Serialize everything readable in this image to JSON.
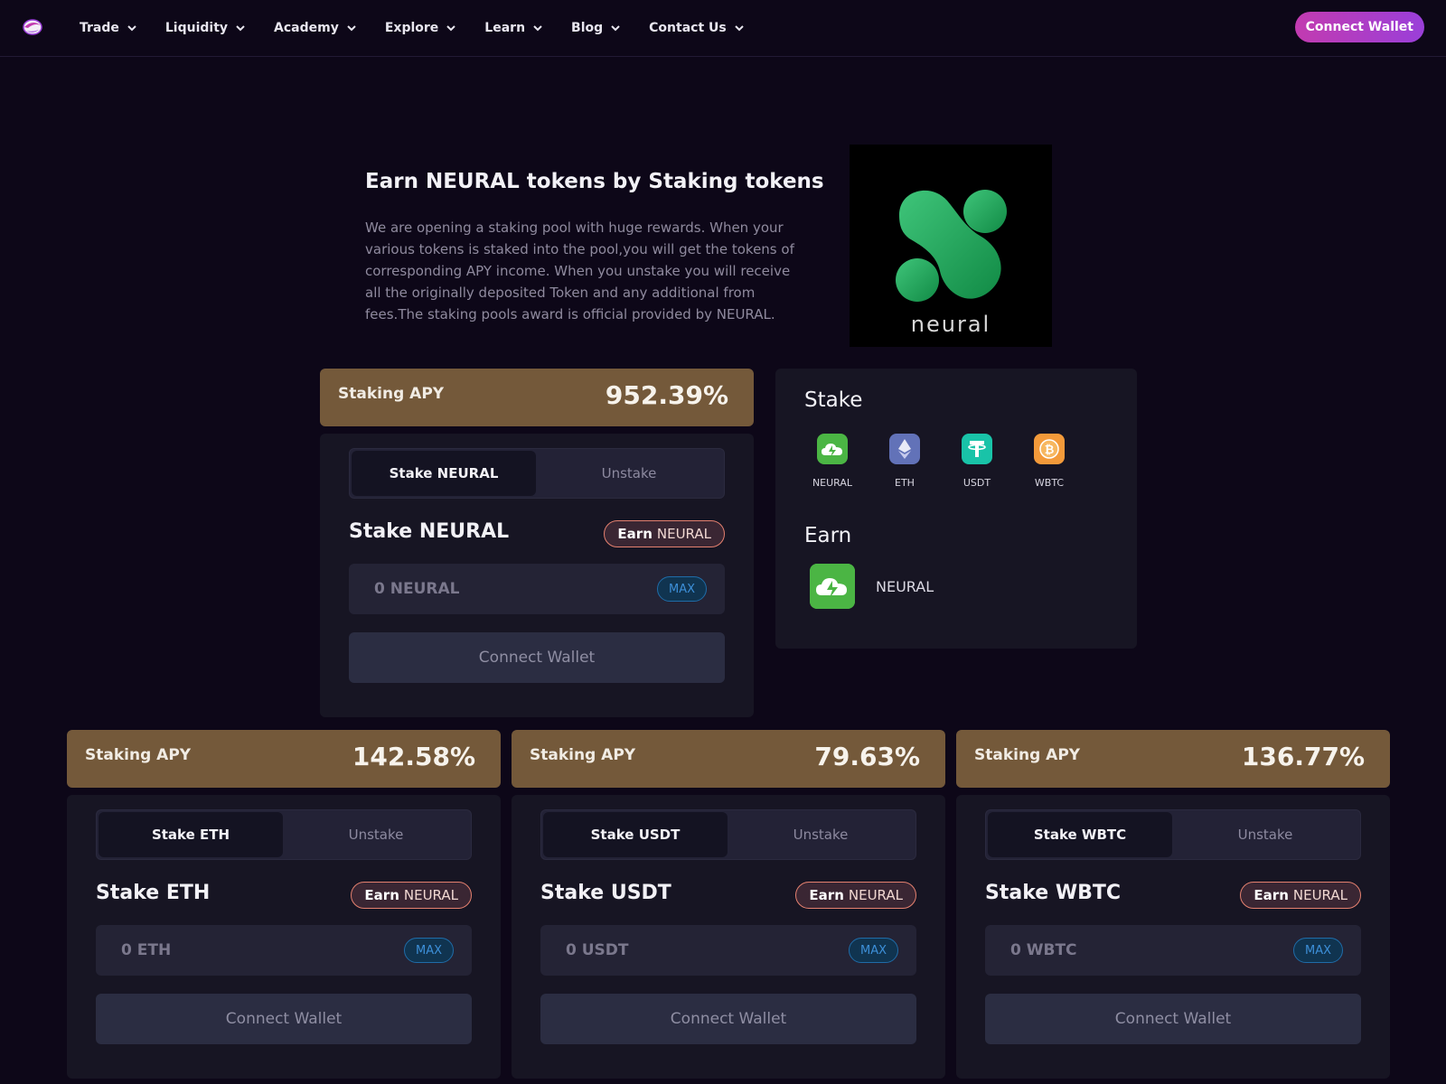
{
  "nav": {
    "items": [
      "Trade",
      "Liquidity",
      "Academy",
      "Explore",
      "Learn",
      "Blog",
      "Contact Us"
    ],
    "connect_label": "Connect Wallet"
  },
  "hero": {
    "title": "Earn NEURAL tokens by Staking tokens",
    "description": "We are opening a staking pool with huge rewards. When your various tokens is staked into the pool,you will get the tokens of corresponding APY income. When you unstake you will receive all the originally deposited Token and any additional from fees.The staking pools award is official provided by NEURAL.",
    "logo_text": "neural"
  },
  "pools": [
    {
      "apy_label": "Staking APY",
      "apy": "952.39%",
      "tab_stake": "Stake NEURAL",
      "tab_unstake": "Unstake",
      "title": "Stake NEURAL",
      "earn_word": "Earn",
      "earn_token": "NEURAL",
      "amount": "0 NEURAL",
      "max": "MAX",
      "button": "Connect Wallet"
    },
    {
      "apy_label": "Staking APY",
      "apy": "142.58%",
      "tab_stake": "Stake ETH",
      "tab_unstake": "Unstake",
      "title": "Stake ETH",
      "earn_word": "Earn",
      "earn_token": "NEURAL",
      "amount": "0 ETH",
      "max": "MAX",
      "button": "Connect Wallet"
    },
    {
      "apy_label": "Staking APY",
      "apy": "79.63%",
      "tab_stake": "Stake USDT",
      "tab_unstake": "Unstake",
      "title": "Stake USDT",
      "earn_word": "Earn",
      "earn_token": "NEURAL",
      "amount": "0 USDT",
      "max": "MAX",
      "button": "Connect Wallet"
    },
    {
      "apy_label": "Staking APY",
      "apy": "136.77%",
      "tab_stake": "Stake WBTC",
      "tab_unstake": "Unstake",
      "title": "Stake WBTC",
      "earn_word": "Earn",
      "earn_token": "NEURAL",
      "amount": "0 WBTC",
      "max": "MAX",
      "button": "Connect Wallet"
    }
  ],
  "info": {
    "stake_heading": "Stake",
    "tokens": [
      {
        "label": "NEURAL",
        "icon": "neural-cloud-icon",
        "color": "#4bb544"
      },
      {
        "label": "ETH",
        "icon": "eth-icon",
        "color": "#6272b8"
      },
      {
        "label": "USDT",
        "icon": "usdt-icon",
        "color": "#19c3a8"
      },
      {
        "label": "WBTC",
        "icon": "wbtc-icon",
        "color": "#f39a3a"
      }
    ],
    "earn_heading": "Earn",
    "earn_token": "NEURAL"
  },
  "colors": {
    "background": "#0d0718",
    "apy_banner": "#74593a",
    "card": "#171523",
    "accent": "#c23bb0",
    "max": "#3d8fd8"
  }
}
